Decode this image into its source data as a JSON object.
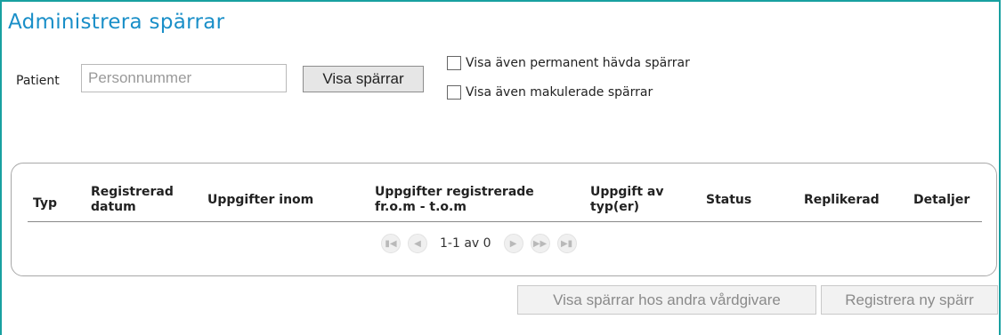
{
  "page": {
    "title": "Administrera spärrar"
  },
  "filter": {
    "patient_label": "Patient",
    "personnummer_placeholder": "Personnummer",
    "personnummer_value": "",
    "show_button": "Visa spärrar",
    "checkbox_permanent": {
      "label": "Visa även permanent hävda spärrar",
      "checked": false
    },
    "checkbox_makulerade": {
      "label": "Visa även makulerade spärrar",
      "checked": false
    }
  },
  "table": {
    "columns": [
      "Typ",
      "Registrerad datum",
      "Uppgifter inom",
      "Uppgifter registrerade fr.o.m - t.o.m",
      "Uppgift av typ(er)",
      "Status",
      "Replikerad",
      "Detaljer"
    ],
    "column_lines": {
      "registrerad_1": "Registrerad",
      "registrerad_2": "datum",
      "uppgifter_reg_1": "Uppgifter registrerade",
      "uppgifter_reg_2": "fr.o.m - t.o.m",
      "uppgift_typ_1": "Uppgift av",
      "uppgift_typ_2": "typ(er)"
    },
    "rows": [],
    "pager": {
      "text": "1-1 av 0",
      "icons": [
        "first-page-icon",
        "previous-page-icon",
        "next-page-icon",
        "fast-forward-icon",
        "last-page-icon"
      ]
    }
  },
  "actions": {
    "other_providers": "Visa spärrar hos andra vårdgivare",
    "register_new": "Registrera ny spärr"
  },
  "colors": {
    "title": "#1a8fc8",
    "frame": "#18a0a0"
  }
}
